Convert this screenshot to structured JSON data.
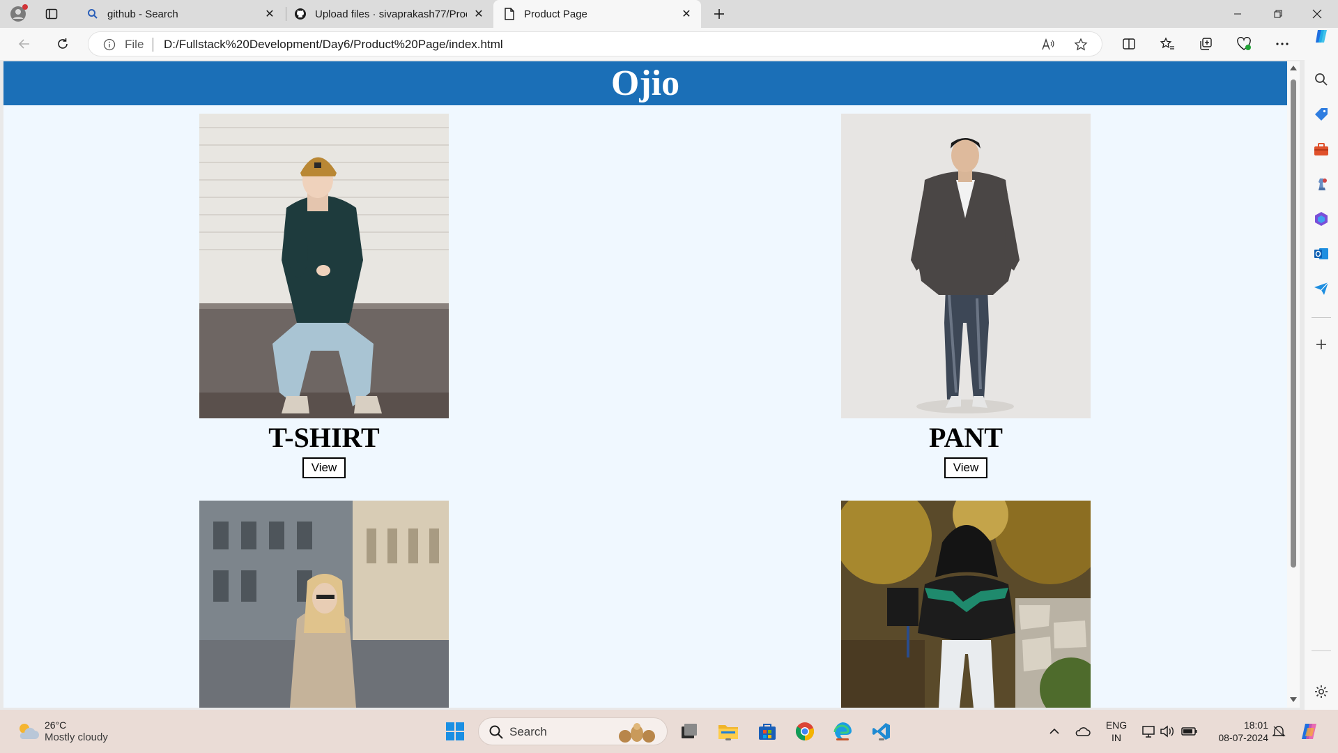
{
  "browser": {
    "tabs": [
      {
        "title": "github - Search",
        "favicon": "search-icon",
        "active": false
      },
      {
        "title": "Upload files · sivaprakash77/Prod",
        "favicon": "github-icon",
        "active": false
      },
      {
        "title": "Product Page",
        "favicon": "page-icon",
        "active": true
      }
    ],
    "address": {
      "scheme_label": "File",
      "url": "D:/Fullstack%20Development/Day6/Product%20Page/index.html"
    }
  },
  "page": {
    "site_title": "Ojio",
    "products": [
      {
        "name": "T-SHIRT",
        "button": "View"
      },
      {
        "name": "PANT",
        "button": "View"
      },
      {
        "name": "",
        "button": ""
      },
      {
        "name": "",
        "button": ""
      }
    ]
  },
  "taskbar": {
    "weather": {
      "temp": "26°C",
      "condition": "Mostly cloudy"
    },
    "search_label": "Search",
    "language": {
      "line1": "ENG",
      "line2": "IN"
    },
    "clock": {
      "time": "18:01",
      "date": "08-07-2024"
    }
  },
  "colors": {
    "header_blue": "#1b6fb7",
    "page_bg": "#f0f8ff",
    "taskbar_bg": "#eadcd6"
  }
}
